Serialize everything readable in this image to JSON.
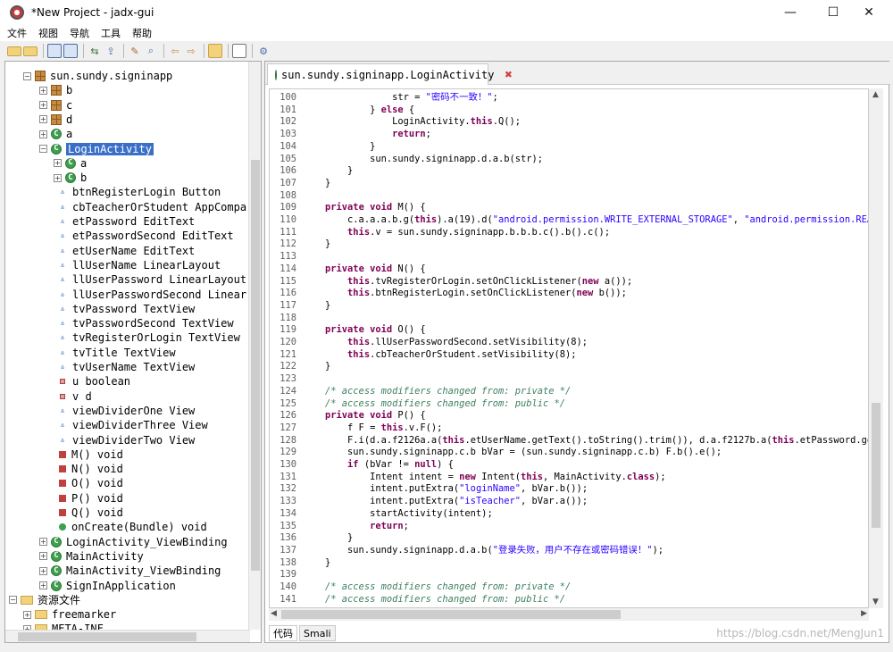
{
  "window": {
    "title": "*New Project - jadx-gui",
    "minimize": "—",
    "maximize": "☐",
    "close": "✕"
  },
  "menu": [
    "文件",
    "视图",
    "导航",
    "工具",
    "帮助"
  ],
  "toolbar": [
    "folder-open-icon",
    "folder-add-icon",
    "copy-icon",
    "copy-all-icon",
    "sync-icon",
    "export-icon",
    "tool-icon",
    "search-icon",
    "back-icon",
    "forward-icon",
    "deobf-icon",
    "log-icon",
    "prefs-icon"
  ],
  "tree": {
    "items": [
      {
        "label": "sun.sundy.signinapp",
        "icon": "pkg",
        "exp": "⊟"
      },
      {
        "label": "b",
        "icon": "pkg",
        "exp": "⊞"
      },
      {
        "label": "c",
        "icon": "pkg",
        "exp": "⊞"
      },
      {
        "label": "d",
        "icon": "pkg",
        "exp": "⊞"
      },
      {
        "label": "a",
        "icon": "cls",
        "exp": "⊞"
      },
      {
        "label": "LoginActivity",
        "icon": "cls",
        "exp": "⊟",
        "selected": true
      },
      {
        "label": "a",
        "icon": "cls",
        "exp": "⊞"
      },
      {
        "label": "b",
        "icon": "cls",
        "exp": "⊞"
      },
      {
        "label": "btnRegisterLogin Button",
        "icon": "field"
      },
      {
        "label": "cbTeacherOrStudent AppCompa",
        "icon": "field"
      },
      {
        "label": "etPassword EditText",
        "icon": "field"
      },
      {
        "label": "etPasswordSecond EditText",
        "icon": "field"
      },
      {
        "label": "etUserName EditText",
        "icon": "field"
      },
      {
        "label": "llUserName LinearLayout",
        "icon": "field"
      },
      {
        "label": "llUserPassword LinearLayout",
        "icon": "field"
      },
      {
        "label": "llUserPasswordSecond Linear",
        "icon": "field"
      },
      {
        "label": "tvPassword TextView",
        "icon": "field"
      },
      {
        "label": "tvPasswordSecond TextView",
        "icon": "field"
      },
      {
        "label": "tvRegisterOrLogin TextView",
        "icon": "field"
      },
      {
        "label": "tvTitle TextView",
        "icon": "field"
      },
      {
        "label": "tvUserName TextView",
        "icon": "field"
      },
      {
        "label": "u boolean",
        "icon": "field-priv"
      },
      {
        "label": "v d",
        "icon": "field-priv"
      },
      {
        "label": "viewDividerOne View",
        "icon": "field"
      },
      {
        "label": "viewDividerThree View",
        "icon": "field"
      },
      {
        "label": "viewDividerTwo View",
        "icon": "field"
      },
      {
        "label": "M() void",
        "icon": "method"
      },
      {
        "label": "N() void",
        "icon": "method"
      },
      {
        "label": "O() void",
        "icon": "method"
      },
      {
        "label": "P() void",
        "icon": "method"
      },
      {
        "label": "Q() void",
        "icon": "method"
      },
      {
        "label": "onCreate(Bundle) void",
        "icon": "method-pub"
      },
      {
        "label": "LoginActivity_ViewBinding",
        "icon": "cls",
        "exp": "⊞"
      },
      {
        "label": "MainActivity",
        "icon": "cls",
        "exp": "⊞"
      },
      {
        "label": "MainActivity_ViewBinding",
        "icon": "cls",
        "exp": "⊞"
      },
      {
        "label": "SignInApplication",
        "icon": "cls",
        "exp": "⊞"
      },
      {
        "label": "资源文件",
        "icon": "folder",
        "exp": "⊟"
      },
      {
        "label": "freemarker",
        "icon": "folder",
        "exp": "⊞"
      },
      {
        "label": "META-INF",
        "icon": "folder",
        "exp": "⊞"
      }
    ]
  },
  "tab": {
    "label": "sun.sundy.signinapp.LoginActivity",
    "close": "✖"
  },
  "code": [
    {
      "n": "100",
      "t": [
        [
          "tk",
          "                str = "
        ],
        [
          "str",
          "\"密码不一致！\""
        ],
        [
          "tk",
          ";"
        ]
      ]
    },
    {
      "n": "101",
      "t": [
        [
          "tk",
          "            } "
        ],
        [
          "kw",
          "else"
        ],
        [
          "tk",
          " {"
        ]
      ]
    },
    {
      "n": "102",
      "t": [
        [
          "tk",
          "                LoginActivity."
        ],
        [
          "kw",
          "this"
        ],
        [
          "tk",
          ".Q();"
        ]
      ]
    },
    {
      "n": "103",
      "t": [
        [
          "tk",
          "                "
        ],
        [
          "kw",
          "return"
        ],
        [
          "tk",
          ";"
        ]
      ]
    },
    {
      "n": "104",
      "t": [
        [
          "tk",
          "            }"
        ]
      ]
    },
    {
      "n": "105",
      "t": [
        [
          "tk",
          "            sun.sundy.signinapp.d.a.b(str);"
        ]
      ]
    },
    {
      "n": "106",
      "t": [
        [
          "tk",
          "        }"
        ]
      ]
    },
    {
      "n": "107",
      "t": [
        [
          "tk",
          "    }"
        ]
      ]
    },
    {
      "n": "108",
      "t": [
        [
          "tk",
          ""
        ]
      ]
    },
    {
      "n": "109",
      "t": [
        [
          "tk",
          "    "
        ],
        [
          "kw",
          "private void"
        ],
        [
          "tk",
          " M() {"
        ]
      ]
    },
    {
      "n": "110",
      "t": [
        [
          "tk",
          "        c.a.a.a.b.g("
        ],
        [
          "kw",
          "this"
        ],
        [
          "tk",
          ").a(19).d("
        ],
        [
          "str",
          "\"android.permission.WRITE_EXTERNAL_STORAGE\""
        ],
        [
          "tk",
          ", "
        ],
        [
          "str",
          "\"android.permission.READ_EX"
        ]
      ]
    },
    {
      "n": "111",
      "t": [
        [
          "tk",
          "        "
        ],
        [
          "kw",
          "this"
        ],
        [
          "tk",
          ".v = sun.sundy.signinapp.b.b.b.c().b().c();"
        ]
      ]
    },
    {
      "n": "112",
      "t": [
        [
          "tk",
          "    }"
        ]
      ]
    },
    {
      "n": "113",
      "t": [
        [
          "tk",
          ""
        ]
      ]
    },
    {
      "n": "114",
      "t": [
        [
          "tk",
          "    "
        ],
        [
          "kw",
          "private void"
        ],
        [
          "tk",
          " N() {"
        ]
      ]
    },
    {
      "n": "115",
      "t": [
        [
          "tk",
          "        "
        ],
        [
          "kw",
          "this"
        ],
        [
          "tk",
          ".tvRegisterOrLogin.setOnClickListener("
        ],
        [
          "kw",
          "new"
        ],
        [
          "tk",
          " a());"
        ]
      ]
    },
    {
      "n": "116",
      "t": [
        [
          "tk",
          "        "
        ],
        [
          "kw",
          "this"
        ],
        [
          "tk",
          ".btnRegisterLogin.setOnClickListener("
        ],
        [
          "kw",
          "new"
        ],
        [
          "tk",
          " b());"
        ]
      ]
    },
    {
      "n": "117",
      "t": [
        [
          "tk",
          "    }"
        ]
      ]
    },
    {
      "n": "118",
      "t": [
        [
          "tk",
          ""
        ]
      ]
    },
    {
      "n": "119",
      "t": [
        [
          "tk",
          "    "
        ],
        [
          "kw",
          "private void"
        ],
        [
          "tk",
          " O() {"
        ]
      ]
    },
    {
      "n": "120",
      "t": [
        [
          "tk",
          "        "
        ],
        [
          "kw",
          "this"
        ],
        [
          "tk",
          ".llUserPasswordSecond.setVisibility(8);"
        ]
      ]
    },
    {
      "n": "121",
      "t": [
        [
          "tk",
          "        "
        ],
        [
          "kw",
          "this"
        ],
        [
          "tk",
          ".cbTeacherOrStudent.setVisibility(8);"
        ]
      ]
    },
    {
      "n": "122",
      "t": [
        [
          "tk",
          "    }"
        ]
      ]
    },
    {
      "n": "123",
      "t": [
        [
          "tk",
          ""
        ]
      ]
    },
    {
      "n": "124",
      "t": [
        [
          "cmt",
          "    /* access modifiers changed from: private */"
        ]
      ]
    },
    {
      "n": "125",
      "t": [
        [
          "cmt",
          "    /* access modifiers changed from: public */"
        ]
      ]
    },
    {
      "n": "126",
      "t": [
        [
          "tk",
          "    "
        ],
        [
          "kw",
          "private void"
        ],
        [
          "tk",
          " P() {"
        ]
      ]
    },
    {
      "n": "127",
      "t": [
        [
          "tk",
          "        f F = "
        ],
        [
          "kw",
          "this"
        ],
        [
          "tk",
          ".v.F();"
        ]
      ]
    },
    {
      "n": "128",
      "t": [
        [
          "tk",
          "        F.i(d.a.f2126a.a("
        ],
        [
          "kw",
          "this"
        ],
        [
          "tk",
          ".etUserName.getText().toString().trim()), d.a.f2127b.a("
        ],
        [
          "kw",
          "this"
        ],
        [
          "tk",
          ".etPassword.getTex"
        ]
      ]
    },
    {
      "n": "129",
      "t": [
        [
          "tk",
          "        sun.sundy.signinapp.c.b bVar = (sun.sundy.signinapp.c.b) F.b().e();"
        ]
      ]
    },
    {
      "n": "130",
      "t": [
        [
          "tk",
          "        "
        ],
        [
          "kw",
          "if"
        ],
        [
          "tk",
          " (bVar != "
        ],
        [
          "kw",
          "null"
        ],
        [
          "tk",
          ") {"
        ]
      ]
    },
    {
      "n": "131",
      "t": [
        [
          "tk",
          "            Intent intent = "
        ],
        [
          "kw",
          "new"
        ],
        [
          "tk",
          " Intent("
        ],
        [
          "kw",
          "this"
        ],
        [
          "tk",
          ", MainActivity."
        ],
        [
          "kw",
          "class"
        ],
        [
          "tk",
          ");"
        ]
      ]
    },
    {
      "n": "132",
      "t": [
        [
          "tk",
          "            intent.putExtra("
        ],
        [
          "str",
          "\"loginName\""
        ],
        [
          "tk",
          ", bVar.b());"
        ]
      ]
    },
    {
      "n": "133",
      "t": [
        [
          "tk",
          "            intent.putExtra("
        ],
        [
          "str",
          "\"isTeacher\""
        ],
        [
          "tk",
          ", bVar.a());"
        ]
      ]
    },
    {
      "n": "134",
      "t": [
        [
          "tk",
          "            startActivity(intent);"
        ]
      ]
    },
    {
      "n": "135",
      "t": [
        [
          "tk",
          "            "
        ],
        [
          "kw",
          "return"
        ],
        [
          "tk",
          ";"
        ]
      ]
    },
    {
      "n": "136",
      "t": [
        [
          "tk",
          "        }"
        ]
      ]
    },
    {
      "n": "137",
      "t": [
        [
          "tk",
          "        sun.sundy.signinapp.d.a.b("
        ],
        [
          "str",
          "\"登录失败，用户不存在或密码错误！\""
        ],
        [
          "tk",
          ");"
        ]
      ]
    },
    {
      "n": "138",
      "t": [
        [
          "tk",
          "    }"
        ]
      ]
    },
    {
      "n": "139",
      "t": [
        [
          "tk",
          ""
        ]
      ]
    },
    {
      "n": "140",
      "t": [
        [
          "cmt",
          "    /* access modifiers changed from: private */"
        ]
      ]
    },
    {
      "n": "141",
      "t": [
        [
          "cmt",
          "    /* access modifiers changed from: public */"
        ]
      ]
    }
  ],
  "bottom_tabs": [
    "代码",
    "Smali"
  ],
  "watermark": "https://blog.csdn.net/MengJun1"
}
